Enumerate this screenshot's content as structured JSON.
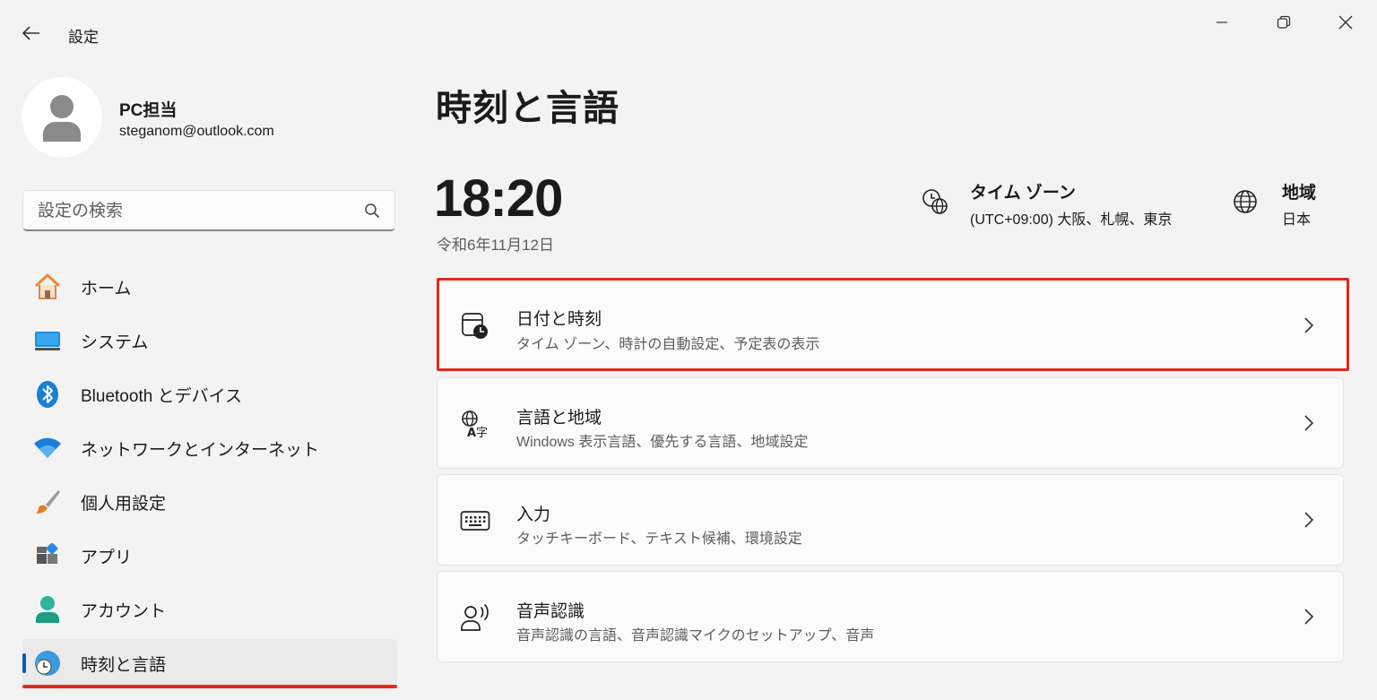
{
  "window": {
    "title": "設定"
  },
  "profile": {
    "name": "PC担当",
    "email": "steganom@outlook.com"
  },
  "search": {
    "placeholder": "設定の検索"
  },
  "nav": {
    "items": [
      {
        "label": "ホーム",
        "icon": "home-icon"
      },
      {
        "label": "システム",
        "icon": "system-icon"
      },
      {
        "label": "Bluetooth とデバイス",
        "icon": "bluetooth-icon"
      },
      {
        "label": "ネットワークとインターネット",
        "icon": "wifi-icon"
      },
      {
        "label": "個人用設定",
        "icon": "brush-icon"
      },
      {
        "label": "アプリ",
        "icon": "apps-icon"
      },
      {
        "label": "アカウント",
        "icon": "account-icon"
      },
      {
        "label": "時刻と言語",
        "icon": "time-language-icon",
        "selected": true
      }
    ]
  },
  "main": {
    "title": "時刻と言語",
    "time": "18:20",
    "date": "令和6年11月12日",
    "timezone": {
      "title": "タイム ゾーン",
      "value": "(UTC+09:00) 大阪、札幌、東京"
    },
    "region": {
      "title": "地域",
      "value": "日本"
    },
    "cards": [
      {
        "title": "日付と時刻",
        "subtitle": "タイム ゾーン、時計の自動設定、予定表の表示",
        "icon": "calendar-clock-icon"
      },
      {
        "title": "言語と地域",
        "subtitle": "Windows 表示言語、優先する言語、地域設定",
        "icon": "language-icon"
      },
      {
        "title": "入力",
        "subtitle": "タッチキーボード、テキスト候補、環境設定",
        "icon": "keyboard-icon"
      },
      {
        "title": "音声認識",
        "subtitle": "音声認識の言語、音声認識マイクのセットアップ、音声",
        "icon": "speech-icon"
      }
    ]
  },
  "colors": {
    "accent": "#005fb8",
    "highlight": "#e4281b",
    "background": "#f3f3f3",
    "card": "#fbfbfb"
  }
}
